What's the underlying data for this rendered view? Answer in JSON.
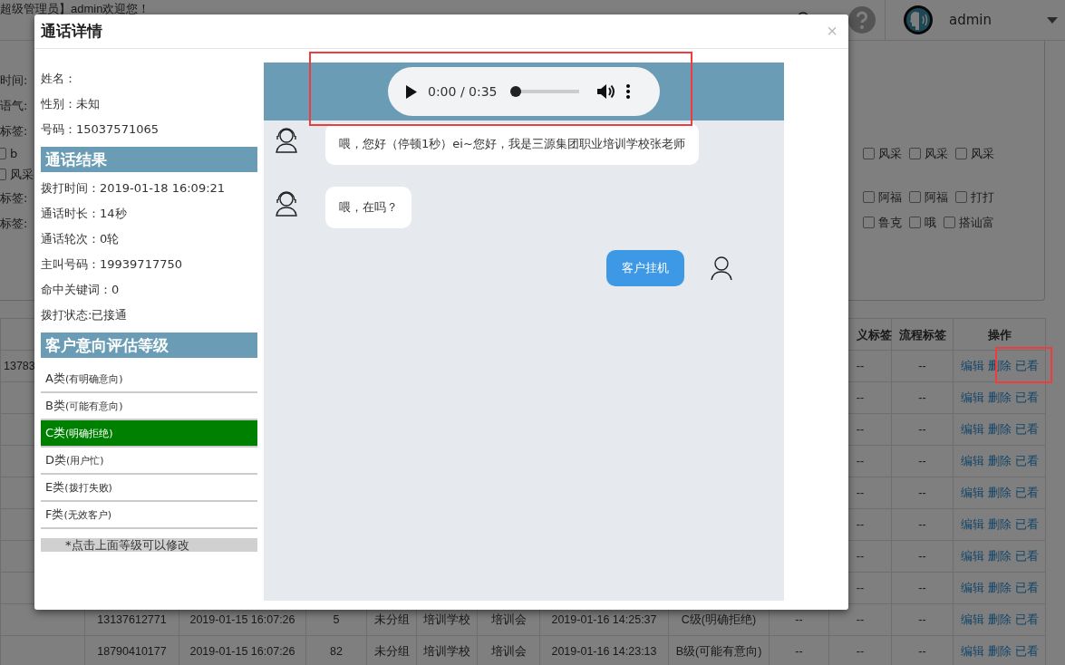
{
  "header": {
    "welcome": "超级管理员】admin欢迎您！",
    "user": "admin"
  },
  "filter_rows": [
    {
      "label": "时间:"
    },
    {
      "label": "语气:"
    },
    {
      "label": "标签:",
      "options": [
        {
          "text": "b",
          "checked": false
        },
        {
          "text": "风采",
          "checked": false
        }
      ],
      "more_options": [
        {
          "text": "风采",
          "checked": false
        },
        {
          "text": "风采",
          "checked": false
        },
        {
          "text": "风采",
          "checked": false
        }
      ]
    },
    {
      "label": "标签:",
      "more_options": [
        {
          "text": "阿福",
          "checked": false
        },
        {
          "text": "阿福",
          "checked": false
        },
        {
          "text": "打打",
          "checked": false
        }
      ]
    },
    {
      "label": "标签:",
      "more_options": [
        {
          "text": "鲁克",
          "checked": false
        },
        {
          "text": "哦",
          "checked": false
        },
        {
          "text": "搭讪富",
          "checked": false
        }
      ]
    }
  ],
  "table": {
    "columns": [
      {},
      {},
      {},
      {},
      {},
      {},
      {},
      {},
      {},
      {},
      {
        "header": "义标签"
      },
      {
        "header": "流程标签"
      },
      {
        "header": "操作"
      }
    ],
    "rows": [
      {
        "cells": [
          "13783",
          null,
          null,
          null,
          null,
          null,
          null,
          null,
          null,
          null,
          "--",
          "--"
        ],
        "actions": [
          "编辑",
          "删除",
          "已看"
        ]
      },
      {
        "cells": [
          null,
          null,
          null,
          null,
          null,
          null,
          null,
          null,
          null,
          null,
          "--",
          "--"
        ],
        "actions": [
          "编辑",
          "删除",
          "已看"
        ]
      },
      {
        "cells": [
          null,
          null,
          null,
          null,
          null,
          null,
          null,
          null,
          null,
          null,
          "--",
          "--"
        ],
        "actions": [
          "编辑",
          "删除",
          "已看"
        ]
      },
      {
        "cells": [
          null,
          null,
          null,
          null,
          null,
          null,
          null,
          null,
          null,
          null,
          "--",
          "--"
        ],
        "actions": [
          "编辑",
          "删除",
          "已看"
        ]
      },
      {
        "cells": [
          null,
          null,
          null,
          null,
          null,
          null,
          null,
          null,
          null,
          null,
          "--",
          "--"
        ],
        "actions": [
          "编辑",
          "删除",
          "已看"
        ]
      },
      {
        "cells": [
          null,
          null,
          null,
          null,
          null,
          null,
          null,
          null,
          null,
          null,
          "--",
          "--"
        ],
        "actions": [
          "编辑",
          "删除",
          "已看"
        ]
      },
      {
        "cells": [
          null,
          null,
          null,
          null,
          null,
          null,
          null,
          null,
          null,
          null,
          "--",
          "--"
        ],
        "actions": [
          "编辑",
          "删除",
          "已看"
        ]
      },
      {
        "cells": [
          null,
          null,
          null,
          null,
          null,
          null,
          null,
          null,
          null,
          null,
          "--",
          "--"
        ],
        "actions": [
          "编辑",
          "删除",
          "已看"
        ]
      },
      {
        "cells": [
          null,
          "13137612771",
          "2019-01-15 16:07:26",
          "5",
          "未分组",
          "培训学校",
          "培训会",
          "2019-01-16 14:25:37",
          "C级(明确拒绝)",
          "--",
          "--",
          "--"
        ],
        "actions": [
          "编辑",
          "删除",
          "已看"
        ]
      },
      {
        "cells": [
          null,
          "18790410177",
          "2019-01-15 16:07:26",
          "82",
          "未分组",
          "培训学校",
          "培训会",
          "2019-01-16 14:23:13",
          "B级(可能有意向)",
          "--",
          "--",
          "--"
        ],
        "actions": [
          "编辑",
          "删除",
          "已看"
        ]
      }
    ]
  },
  "dialog": {
    "title": "通话详情",
    "close": "×",
    "contact": [
      "姓名：",
      "性别：未知",
      "号码：15037571065"
    ],
    "result": {
      "title": "通话结果",
      "items": [
        "拨打时间：2019-01-18 16:09:21",
        "通话时长：14秒",
        "通话轮次：0轮",
        "主叫号码：19939717750",
        "命中关键词：0",
        "拨打状态:已接通"
      ]
    },
    "grade": {
      "title": "客户意向评估等级",
      "options": [
        {
          "label": "A类",
          "note": "(有明确意向)",
          "selected": false
        },
        {
          "label": "B类",
          "note": "(可能有意向)",
          "selected": false
        },
        {
          "label": "C类",
          "note": "(明确拒绝)",
          "selected": true
        },
        {
          "label": "D类",
          "note": "(用户忙)",
          "selected": false
        },
        {
          "label": "E类",
          "note": "(拨打失败)",
          "selected": false
        },
        {
          "label": "F类",
          "note": "(无效客户)",
          "selected": false
        }
      ],
      "hint": "*点击上面等级可以修改"
    },
    "player": {
      "time": "0:00 / 0:35",
      "level": 0
    },
    "messages": [
      {
        "kind": "agent",
        "text": "喂，您好（停顿1秒）ei~您好，我是三源集团职业培训学校张老师"
      },
      {
        "kind": "agent",
        "text": "喂，在吗？"
      },
      {
        "kind": "customer",
        "text": "客户挂机"
      }
    ]
  }
}
